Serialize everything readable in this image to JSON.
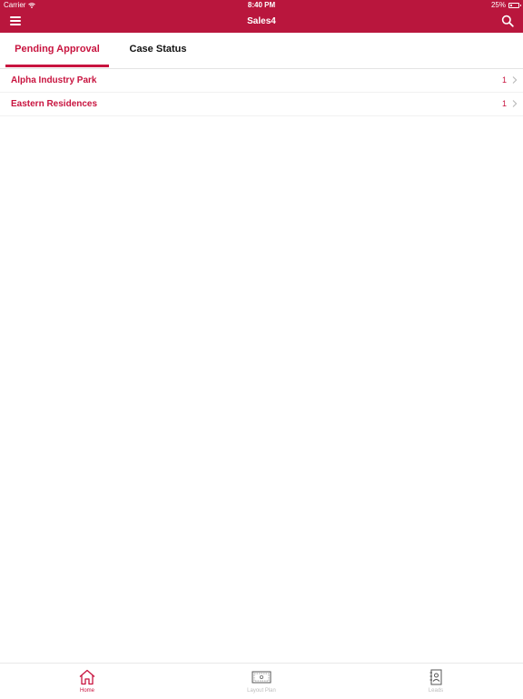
{
  "status_bar": {
    "carrier": "Carrier",
    "time": "8:40 PM",
    "battery_percent": "25%",
    "battery_level": 0.25
  },
  "nav": {
    "title": "Sales4",
    "menu_icon": "hamburger-menu-icon",
    "search_icon": "search-icon"
  },
  "tabs": [
    {
      "label": "Pending Approval",
      "active": true
    },
    {
      "label": "Case Status",
      "active": false
    }
  ],
  "projects": [
    {
      "name": "Alpha Industry Park",
      "count": "1"
    },
    {
      "name": "Eastern Residences",
      "count": "1"
    }
  ],
  "tab_bar": [
    {
      "label": "Home",
      "icon": "home-icon",
      "active": true
    },
    {
      "label": "Layout Plan",
      "icon": "layout-plan-icon",
      "active": false
    },
    {
      "label": "Leads",
      "icon": "contacts-book-icon",
      "active": false
    }
  ],
  "colors": {
    "brand": "#b9163d",
    "accent": "#c8143f",
    "inactive": "#bdbdbd"
  }
}
